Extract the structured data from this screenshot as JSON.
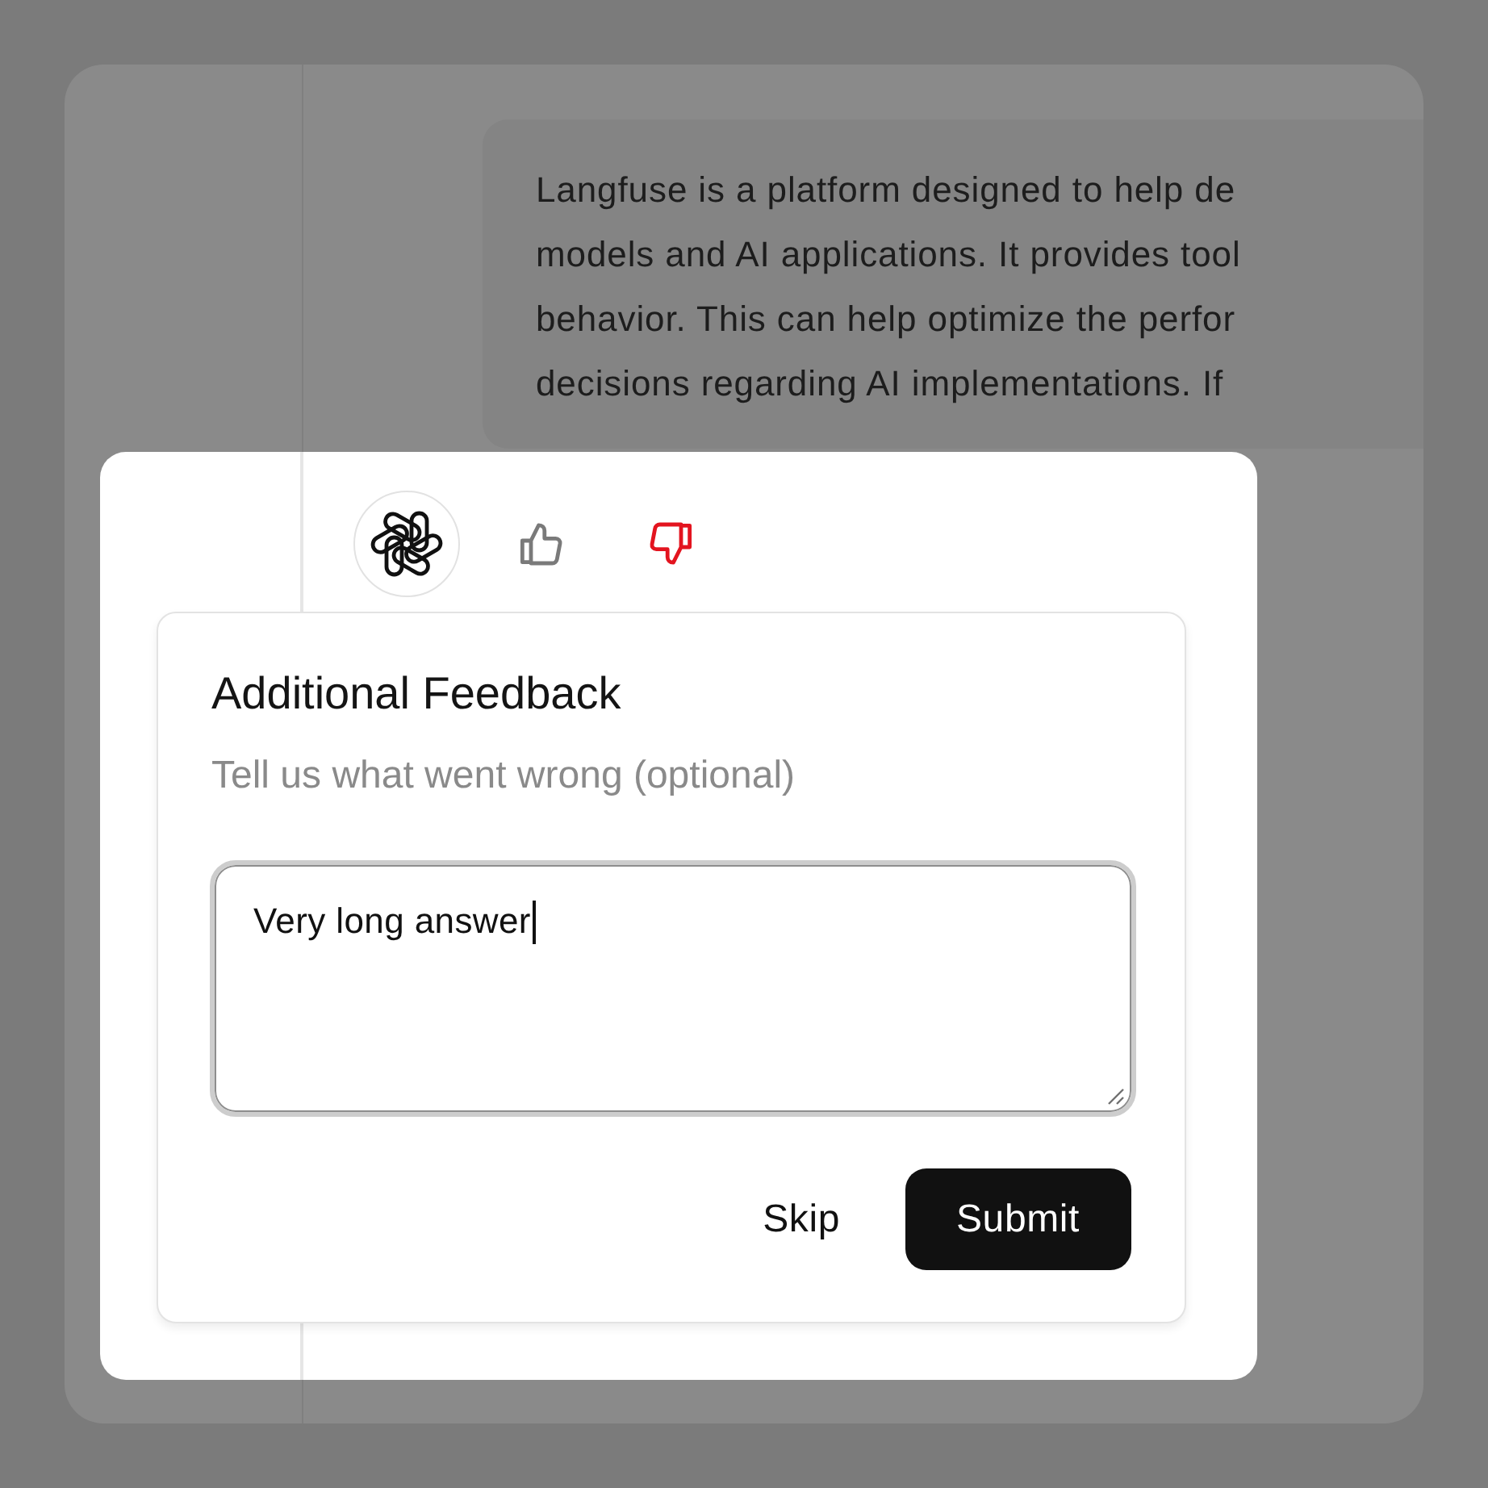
{
  "conversation": {
    "message": {
      "lines": [
        "Langfuse is a platform designed to help de",
        "models and AI applications. It provides tool",
        "behavior. This can help optimize the perfor",
        "decisions regarding AI implementations. If"
      ]
    }
  },
  "feedback": {
    "ratings": [
      {
        "kind": "up",
        "selected": false
      },
      {
        "kind": "down",
        "selected": true
      }
    ],
    "title": "Additional Feedback",
    "subtitle": "Tell us what went wrong (optional)",
    "field": {
      "value": "Very long answer",
      "focused": true
    },
    "buttons": [
      {
        "label": "Skip",
        "kind": "ghost"
      },
      {
        "label": "Submit",
        "kind": "primary"
      }
    ]
  }
}
